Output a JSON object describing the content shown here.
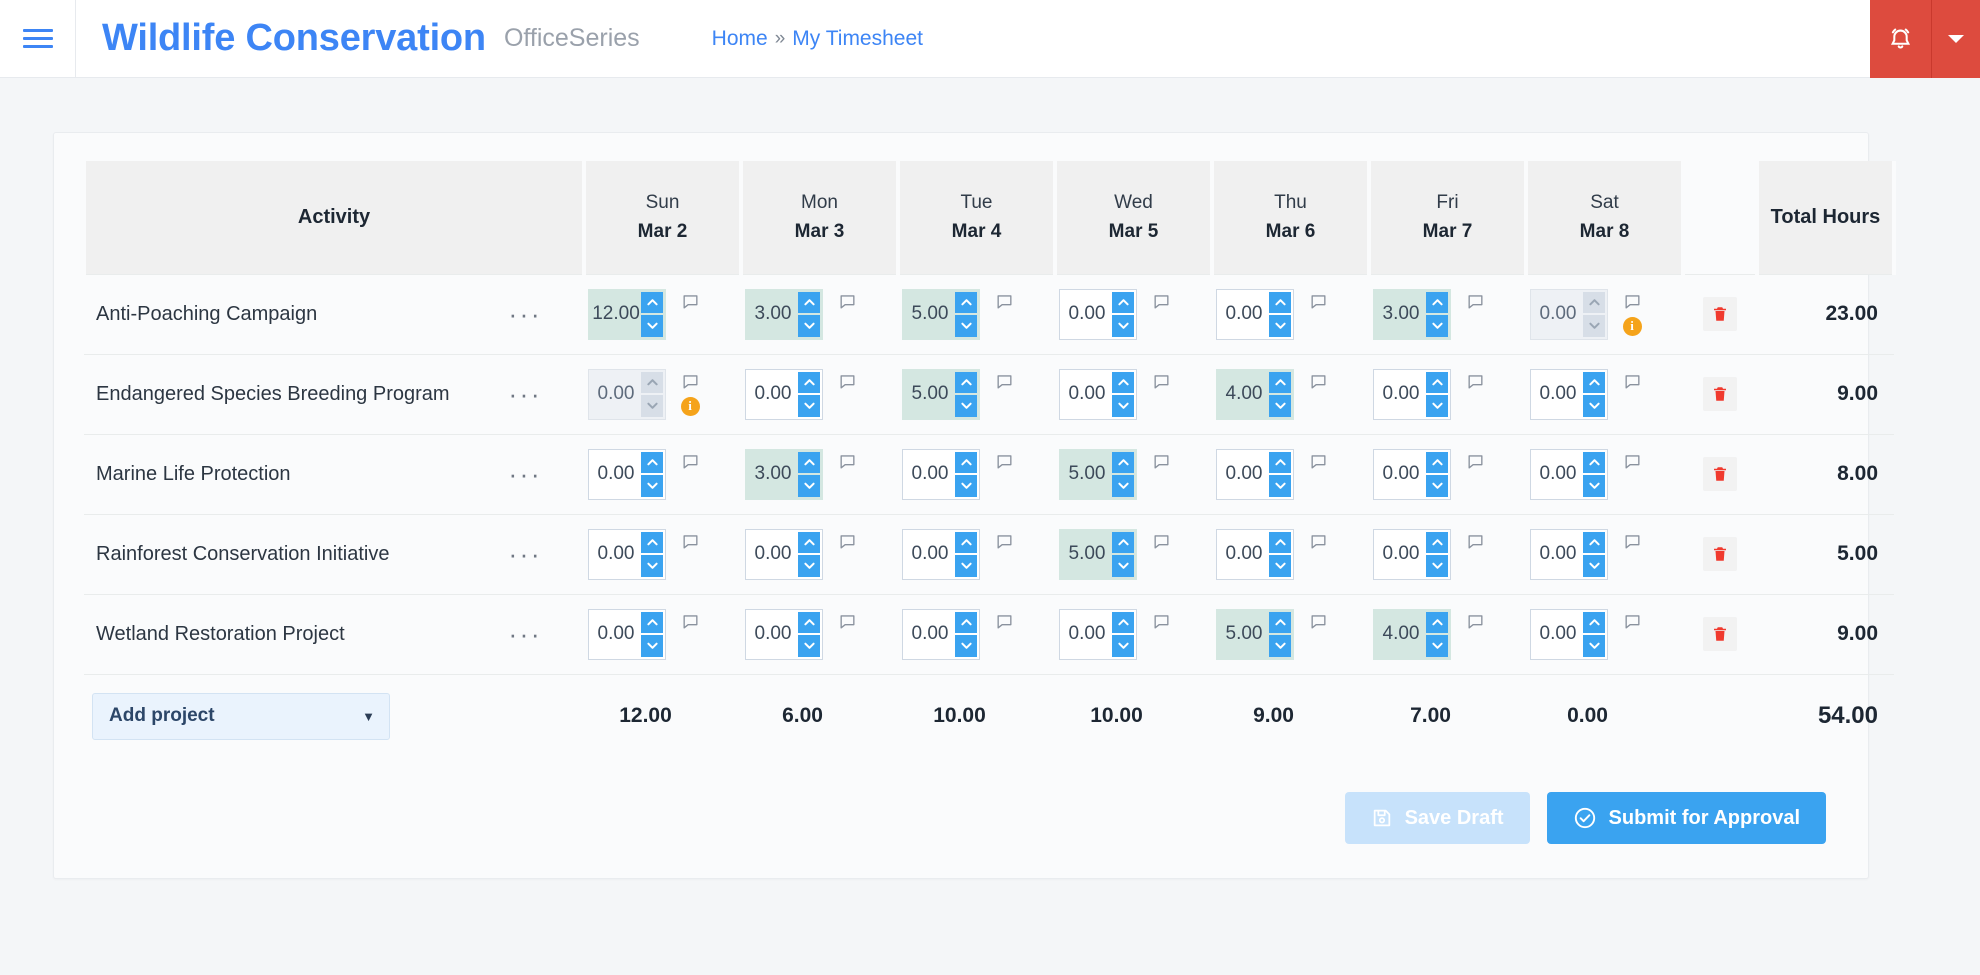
{
  "header": {
    "menu_icon": "hamburger-icon",
    "brand": "Wildlife Conservation",
    "brand_sub": "OfficeSeries",
    "breadcrumb": {
      "home": "Home",
      "separator": "»",
      "current": "My Timesheet"
    },
    "notification_icon": "bell-icon",
    "notification_caret_icon": "chevron-down-icon",
    "accent_blue": "#3d85f5",
    "notification_red": "#dd4b3e"
  },
  "table": {
    "columns": {
      "activity": "Activity",
      "total": "Total Hours"
    },
    "days": [
      {
        "dow": "Sun",
        "dom": "Mar 2"
      },
      {
        "dow": "Mon",
        "dom": "Mar 3"
      },
      {
        "dow": "Tue",
        "dom": "Mar 4"
      },
      {
        "dow": "Wed",
        "dom": "Mar 5"
      },
      {
        "dow": "Thu",
        "dom": "Mar 6"
      },
      {
        "dow": "Fri",
        "dom": "Mar 7"
      },
      {
        "dow": "Sat",
        "dom": "Mar 8"
      }
    ],
    "rows": [
      {
        "activity": "Anti-Poaching Campaign",
        "menu_icon": "ellipsis-icon",
        "delete_icon": "trash-icon",
        "hours": [
          {
            "value": "12.00",
            "state": "filled",
            "info": false
          },
          {
            "value": "3.00",
            "state": "filled",
            "info": false
          },
          {
            "value": "5.00",
            "state": "filled",
            "info": false
          },
          {
            "value": "0.00",
            "state": "empty",
            "info": false
          },
          {
            "value": "0.00",
            "state": "empty",
            "info": false
          },
          {
            "value": "3.00",
            "state": "filled",
            "info": false
          },
          {
            "value": "0.00",
            "state": "disabled",
            "info": true
          }
        ],
        "total": "23.00"
      },
      {
        "activity": "Endangered Species Breeding Program",
        "menu_icon": "ellipsis-icon",
        "delete_icon": "trash-icon",
        "hours": [
          {
            "value": "0.00",
            "state": "disabled",
            "info": true
          },
          {
            "value": "0.00",
            "state": "empty",
            "info": false
          },
          {
            "value": "5.00",
            "state": "filled",
            "info": false
          },
          {
            "value": "0.00",
            "state": "empty",
            "info": false
          },
          {
            "value": "4.00",
            "state": "filled",
            "info": false
          },
          {
            "value": "0.00",
            "state": "empty",
            "info": false
          },
          {
            "value": "0.00",
            "state": "empty",
            "info": false
          }
        ],
        "total": "9.00"
      },
      {
        "activity": "Marine Life Protection",
        "menu_icon": "ellipsis-icon",
        "delete_icon": "trash-icon",
        "hours": [
          {
            "value": "0.00",
            "state": "empty",
            "info": false
          },
          {
            "value": "3.00",
            "state": "filled",
            "info": false
          },
          {
            "value": "0.00",
            "state": "empty",
            "info": false
          },
          {
            "value": "5.00",
            "state": "filled",
            "info": false
          },
          {
            "value": "0.00",
            "state": "empty",
            "info": false
          },
          {
            "value": "0.00",
            "state": "empty",
            "info": false
          },
          {
            "value": "0.00",
            "state": "empty",
            "info": false
          }
        ],
        "total": "8.00"
      },
      {
        "activity": "Rainforest Conservation Initiative",
        "menu_icon": "ellipsis-icon",
        "delete_icon": "trash-icon",
        "hours": [
          {
            "value": "0.00",
            "state": "empty",
            "info": false
          },
          {
            "value": "0.00",
            "state": "empty",
            "info": false
          },
          {
            "value": "0.00",
            "state": "empty",
            "info": false
          },
          {
            "value": "5.00",
            "state": "filled",
            "info": false
          },
          {
            "value": "0.00",
            "state": "empty",
            "info": false
          },
          {
            "value": "0.00",
            "state": "empty",
            "info": false
          },
          {
            "value": "0.00",
            "state": "empty",
            "info": false
          }
        ],
        "total": "5.00"
      },
      {
        "activity": "Wetland Restoration Project",
        "menu_icon": "ellipsis-icon",
        "delete_icon": "trash-icon",
        "hours": [
          {
            "value": "0.00",
            "state": "empty",
            "info": false
          },
          {
            "value": "0.00",
            "state": "empty",
            "info": false
          },
          {
            "value": "0.00",
            "state": "empty",
            "info": false
          },
          {
            "value": "0.00",
            "state": "empty",
            "info": false
          },
          {
            "value": "5.00",
            "state": "filled",
            "info": false
          },
          {
            "value": "4.00",
            "state": "filled",
            "info": false
          },
          {
            "value": "0.00",
            "state": "empty",
            "info": false
          }
        ],
        "total": "9.00"
      }
    ],
    "footer": {
      "add_project_label": "Add project",
      "add_project_caret_icon": "caret-down-icon",
      "day_totals": [
        "12.00",
        "6.00",
        "10.00",
        "10.00",
        "9.00",
        "7.00",
        "0.00"
      ],
      "grand_total": "54.00"
    }
  },
  "actions": {
    "save_draft_label": "Save Draft",
    "save_draft_icon": "save-icon",
    "save_draft_disabled": true,
    "submit_label": "Submit for Approval",
    "submit_icon": "check-circle-icon"
  },
  "scrollbar": {
    "orientation": "vertical",
    "color": "#3aa3f0"
  }
}
